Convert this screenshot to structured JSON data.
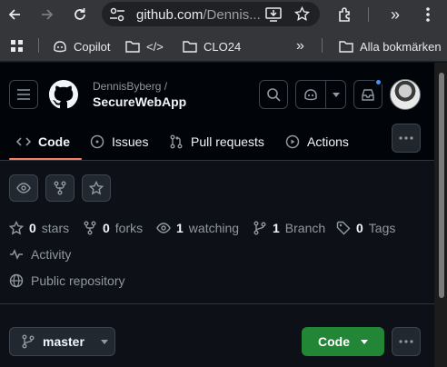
{
  "browser": {
    "url_host": "github.com",
    "url_rest": "/Dennis...",
    "bookmarks": [
      {
        "label": "Copilot"
      },
      {
        "label": "</>"
      },
      {
        "label": "CLO24"
      },
      {
        "label": "Alla bokmärken"
      }
    ],
    "overflow": "»"
  },
  "repo": {
    "owner": "DennisByberg /",
    "name": "SecureWebApp"
  },
  "tabs": [
    {
      "label": "Code",
      "icon": "code-icon",
      "selected": true
    },
    {
      "label": "Issues",
      "icon": "issue-opened-icon"
    },
    {
      "label": "Pull requests",
      "icon": "git-pull-request-icon"
    },
    {
      "label": "Actions",
      "icon": "play-icon"
    }
  ],
  "stats": {
    "stars_count": "0",
    "stars_label": "stars",
    "forks_count": "0",
    "forks_label": "forks",
    "watching_count": "1",
    "watching_label": "watching",
    "branch_count": "1",
    "branch_label": "Branch",
    "tags_count": "0",
    "tags_label": "Tags"
  },
  "activity_label": "Activity",
  "visibility_label": "Public repository",
  "branch_button": {
    "label": "master"
  },
  "code_button": {
    "label": "Code"
  },
  "colors": {
    "primary_button": "#238636",
    "tab_underline": "#f78166",
    "notification_dot": "#4493f8"
  }
}
